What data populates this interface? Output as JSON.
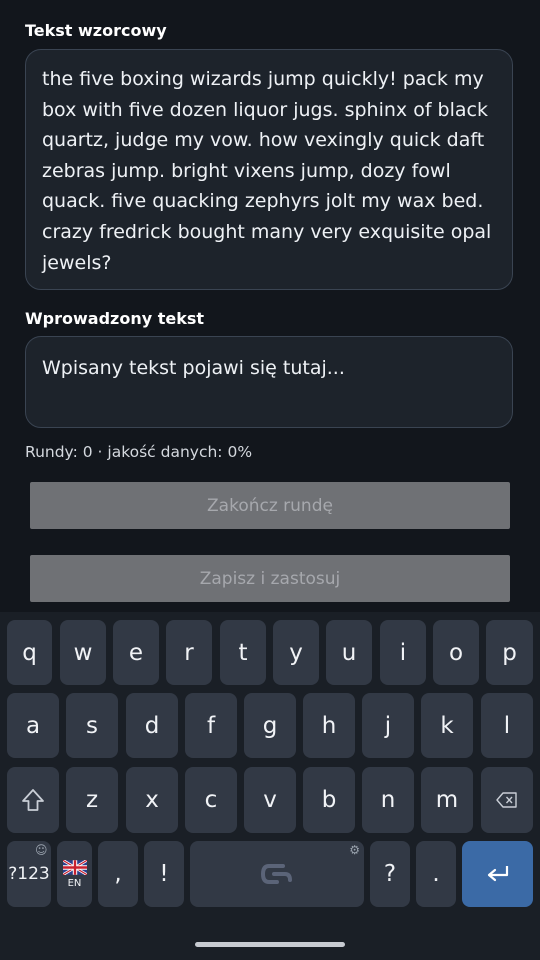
{
  "reference": {
    "label": "Tekst wzorcowy",
    "lines": [
      "the five boxing wizards jump quickly! pack my",
      "box with five dozen liquor jugs. sphinx of black",
      "quartz, judge my vow. how vexingly quick daft",
      "zebras jump. bright vixens jump, dozy fowl",
      "quack. five quacking zephyrs jolt my wax bed.",
      "crazy fredrick bought many very exquisite opal",
      "jewels?"
    ]
  },
  "input": {
    "label": "Wprowadzony tekst",
    "placeholder": "Wpisany tekst pojawi się tutaj..."
  },
  "stats": "Rundy: 0 · jakość danych: 0%",
  "buttons": {
    "end_round": "Zakończ rundę",
    "save_apply": "Zapisz i zastosuj"
  },
  "keyboard": {
    "row1": [
      "q",
      "w",
      "e",
      "r",
      "t",
      "y",
      "u",
      "i",
      "o",
      "p"
    ],
    "row2": [
      "a",
      "s",
      "d",
      "f",
      "g",
      "h",
      "j",
      "k",
      "l"
    ],
    "row3": [
      "z",
      "x",
      "c",
      "v",
      "b",
      "n",
      "m"
    ],
    "symbols_label": "?123",
    "lang_label": "EN",
    "comma": ",",
    "exclaim": "!",
    "question": "?",
    "period": "."
  },
  "icons": {
    "shift": "shift-icon",
    "backspace": "backspace-icon",
    "enter": "enter-icon",
    "emoji": "emoji-icon",
    "flag": "uk-flag-icon",
    "spacebar_logo": "keyboard-logo-icon",
    "settings": "settings-icon"
  },
  "colors": {
    "background": "#12161c",
    "card": "#1d232b",
    "key": "#323945",
    "enter": "#3b6aa6",
    "disabled_button": "#6f7175"
  }
}
